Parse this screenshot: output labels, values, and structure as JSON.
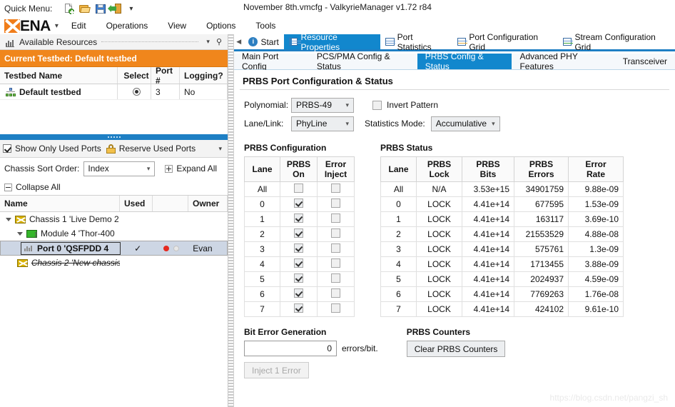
{
  "window": {
    "title": "November 8th.vmcfg - ValkyrieManager v1.72 r84"
  },
  "quick_menu": {
    "label": "Quick Menu:",
    "icons": [
      "new-document-icon",
      "open-folder-icon",
      "save-icon",
      "exit-icon"
    ],
    "overflow_caret": "▾"
  },
  "menubar": {
    "brand": "ENA",
    "brand_caret": "▾",
    "items": [
      "Edit",
      "Operations",
      "View",
      "Options",
      "Tools"
    ]
  },
  "sidebar": {
    "pane_title": "Available Resources",
    "pane_caret": "▾",
    "pane_pin": "⚲",
    "testbed_bar": "Current Testbed: Default testbed",
    "testbed_table": {
      "headers": [
        "Testbed Name",
        "Select",
        "Port #",
        "Logging?"
      ],
      "rows": [
        {
          "name": "Default testbed",
          "select": "selected",
          "port": "3",
          "logging": "No"
        }
      ]
    },
    "options": {
      "show_only_used_ports": "Show Only Used Ports",
      "show_only_used_ports_checked": true,
      "reserve_used_ports": "Reserve Used Ports",
      "overflow_caret": "▾"
    },
    "sort": {
      "label": "Chassis Sort Order:",
      "value": "Index",
      "caret": "▾",
      "expand_all": "Expand All",
      "collapse_all": "Collapse All"
    },
    "tree_table": {
      "headers": [
        "Name",
        "Used",
        "",
        "Owner"
      ],
      "rows": [
        {
          "indent": 0,
          "icon": "chassis-icon",
          "label": "Chassis 1 'Live Demo 2",
          "expanded": true,
          "used": "",
          "leds": "",
          "owner": ""
        },
        {
          "indent": 1,
          "icon": "module-icon",
          "label": "Module 4 'Thor-400",
          "expanded": true,
          "used": "",
          "leds": "",
          "owner": ""
        },
        {
          "indent": 2,
          "icon": "port-icon",
          "label": "Port 0 'QSFPDD 4",
          "selected": true,
          "used": "✓",
          "leds": "red-off",
          "owner": "Evan"
        },
        {
          "indent": 1,
          "icon": "chassis-icon",
          "label": "Chassis 2 'New chassis",
          "strike": true,
          "used": "",
          "leds": "",
          "owner": ""
        }
      ]
    }
  },
  "tabs": {
    "nav_prev": "◀",
    "items": [
      {
        "label": "Start",
        "icon": "info-icon",
        "active": false
      },
      {
        "label": "Resource Properties",
        "icon": "properties-icon",
        "active": true
      },
      {
        "label": "Port Statistics",
        "icon": "statistics-icon",
        "active": false
      },
      {
        "label": "Port Configuration Grid",
        "icon": "port-config-grid-icon",
        "active": false
      },
      {
        "label": "Stream Configuration Grid",
        "icon": "stream-config-grid-icon",
        "active": false
      }
    ]
  },
  "subtabs": {
    "items": [
      {
        "label": "Main Port Config",
        "active": false
      },
      {
        "label": "PCS/PMA Config & Status",
        "active": false
      },
      {
        "label": "PRBS Config & Status",
        "active": true
      },
      {
        "label": "Advanced PHY Features",
        "active": false
      },
      {
        "label": "Transceiver",
        "active": false
      }
    ]
  },
  "main": {
    "title": "PRBS Port Configuration & Status",
    "polynomial": {
      "label": "Polynomial:",
      "value": "PRBS-49",
      "caret": "▾"
    },
    "invert_pattern": {
      "label": "Invert Pattern",
      "checked": false
    },
    "lane_link": {
      "label": "Lane/Link:",
      "value": "PhyLine",
      "caret": "▾"
    },
    "statistics_mode": {
      "label": "Statistics Mode:",
      "value": "Accumulative",
      "caret": "▾"
    },
    "prbs_configuration": {
      "title": "PRBS Configuration",
      "headers": [
        "Lane",
        "PRBS On",
        "Error Inject"
      ],
      "rows": [
        {
          "lane": "All",
          "prbs_on": false,
          "error_inject": false
        },
        {
          "lane": "0",
          "prbs_on": true,
          "error_inject": false
        },
        {
          "lane": "1",
          "prbs_on": true,
          "error_inject": false
        },
        {
          "lane": "2",
          "prbs_on": true,
          "error_inject": false
        },
        {
          "lane": "3",
          "prbs_on": true,
          "error_inject": false
        },
        {
          "lane": "4",
          "prbs_on": true,
          "error_inject": false
        },
        {
          "lane": "5",
          "prbs_on": true,
          "error_inject": false
        },
        {
          "lane": "6",
          "prbs_on": true,
          "error_inject": false
        },
        {
          "lane": "7",
          "prbs_on": true,
          "error_inject": false
        }
      ]
    },
    "prbs_status": {
      "title": "PRBS Status",
      "headers": [
        "Lane",
        "PRBS Lock",
        "PRBS Bits",
        "PRBS Errors",
        "Error Rate"
      ],
      "rows": [
        {
          "lane": "All",
          "lock": "N/A",
          "bits": "3.53e+15",
          "errors": "34901759",
          "rate": "9.88e-09"
        },
        {
          "lane": "0",
          "lock": "LOCK",
          "bits": "4.41e+14",
          "errors": "677595",
          "rate": "1.53e-09"
        },
        {
          "lane": "1",
          "lock": "LOCK",
          "bits": "4.41e+14",
          "errors": "163117",
          "rate": "3.69e-10"
        },
        {
          "lane": "2",
          "lock": "LOCK",
          "bits": "4.41e+14",
          "errors": "21553529",
          "rate": "4.88e-08"
        },
        {
          "lane": "3",
          "lock": "LOCK",
          "bits": "4.41e+14",
          "errors": "575761",
          "rate": "1.3e-09"
        },
        {
          "lane": "4",
          "lock": "LOCK",
          "bits": "4.41e+14",
          "errors": "1713455",
          "rate": "3.88e-09"
        },
        {
          "lane": "5",
          "lock": "LOCK",
          "bits": "4.41e+14",
          "errors": "2024937",
          "rate": "4.59e-09"
        },
        {
          "lane": "6",
          "lock": "LOCK",
          "bits": "4.41e+14",
          "errors": "7769263",
          "rate": "1.76e-08"
        },
        {
          "lane": "7",
          "lock": "LOCK",
          "bits": "4.41e+14",
          "errors": "424102",
          "rate": "9.61e-10"
        }
      ]
    },
    "bit_error_generation": {
      "title": "Bit Error Generation",
      "value": "0",
      "unit": "errors/bit.",
      "inject_button": "Inject 1 Error"
    },
    "prbs_counters": {
      "title": "PRBS Counters",
      "clear_button": "Clear PRBS Counters"
    }
  },
  "watermark": "https://blog.csdn.net/pangzi_sh",
  "colors": {
    "accent_blue": "#1287cd",
    "testbed_orange": "#f0861c",
    "lock_blue": "#2a6ebb",
    "led_red": "#e52a1f",
    "brand_orange": "#f07d1a"
  }
}
